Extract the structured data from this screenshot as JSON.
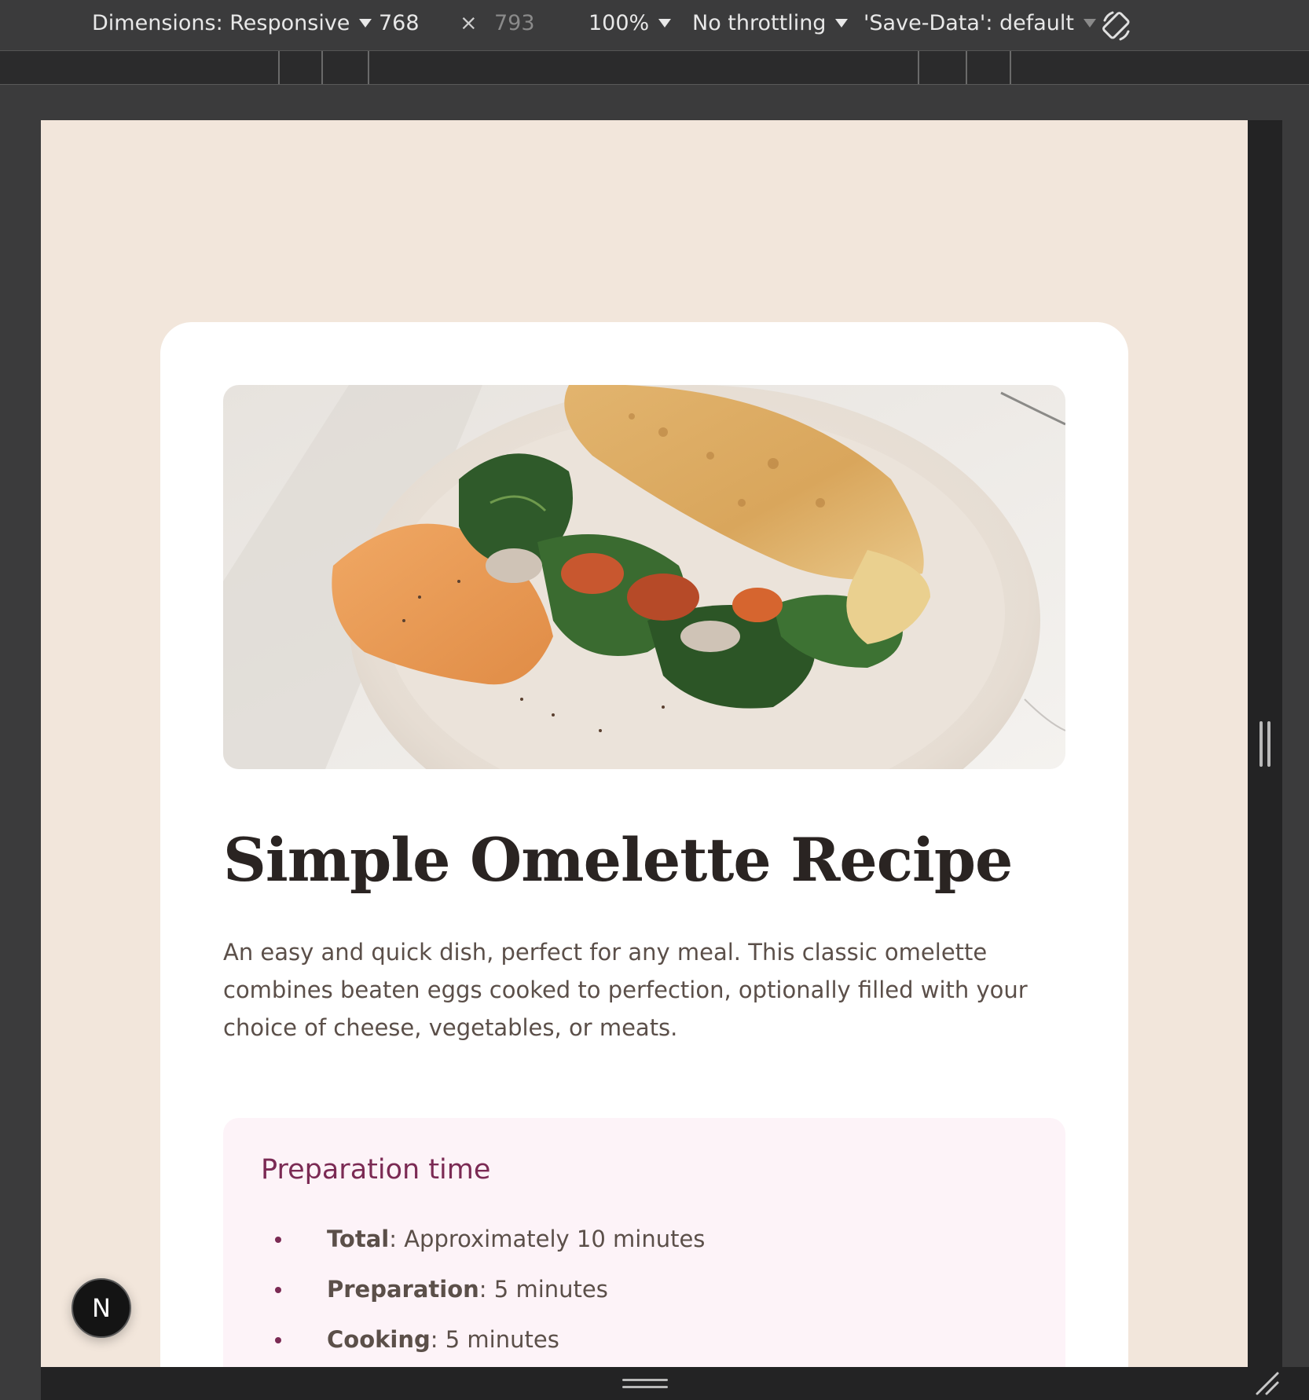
{
  "devtools": {
    "dimensions_label": "Dimensions: Responsive",
    "width_value": "768",
    "times_symbol": "×",
    "height_placeholder": "793",
    "zoom_label": "100%",
    "throttling_label": "No throttling",
    "save_data_label": "'Save-Data': default",
    "rotate_icon": "rotate-icon"
  },
  "recipe": {
    "hero_alt": "Omelette with spinach and vegetables on a plate",
    "title": "Simple Omelette Recipe",
    "description": "An easy and quick dish, perfect for any meal. This classic omelette combines beaten eggs cooked to perfection, optionally filled with your choice of cheese, vegetables, or meats.",
    "preparation": {
      "heading": "Preparation time",
      "items": [
        {
          "label": "Total",
          "value": ": Approximately 10 minutes"
        },
        {
          "label": "Preparation",
          "value": ": 5 minutes"
        },
        {
          "label": "Cooking",
          "value": ": 5 minutes"
        }
      ]
    }
  },
  "nextjs_badge": {
    "letter": "N"
  },
  "colors": {
    "page_bg": "#f2e6db",
    "card_bg": "#ffffff",
    "title": "#2a2422",
    "body_text": "#5b4f49",
    "accent": "#7b2a54",
    "prep_bg": "#fdf3f8"
  }
}
